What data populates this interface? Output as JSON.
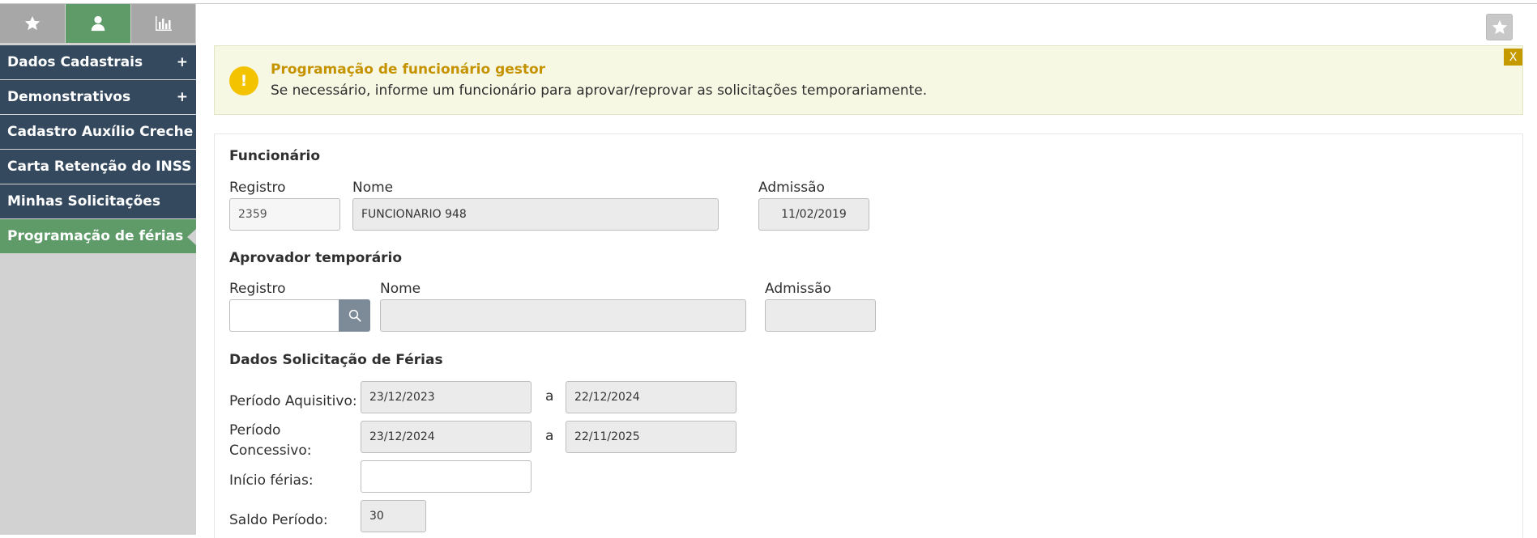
{
  "sidebar": {
    "tabs": [
      {
        "icon": "star-icon",
        "active": false
      },
      {
        "icon": "user-icon",
        "active": true
      },
      {
        "icon": "bar-chart-icon",
        "active": false
      }
    ],
    "items": [
      {
        "label": "Dados Cadastrais",
        "expand": "+"
      },
      {
        "label": "Demonstrativos",
        "expand": "+"
      },
      {
        "label": "Cadastro Auxílio Creche"
      },
      {
        "label": "Carta Retenção do INSS"
      },
      {
        "label": "Minhas Solicitações"
      },
      {
        "label": "Programação de férias",
        "active": true
      }
    ]
  },
  "alert": {
    "title": "Programação de funcionário gestor",
    "text": "Se necessário, informe um funcionário para aprovar/reprovar as solicitações temporariamente.",
    "icon_glyph": "!",
    "close_label": "X",
    "title_color": "#c59300"
  },
  "funcionario": {
    "title": "Funcionário",
    "registro_label": "Registro",
    "registro_value": "2359",
    "nome_label": "Nome",
    "nome_value": "FUNCIONARIO 948",
    "admissao_label": "Admissão",
    "admissao_value": "11/02/2019"
  },
  "aprovador": {
    "title": "Aprovador temporário",
    "registro_label": "Registro",
    "registro_value": "",
    "nome_label": "Nome",
    "nome_value": "",
    "admissao_label": "Admissão",
    "admissao_value": ""
  },
  "ferias": {
    "title": "Dados Solicitação de Férias",
    "aquisitivo_label": "Período Aquisitivo:",
    "aquisitivo_start": "23/12/2023",
    "aquisitivo_end": "22/12/2024",
    "concessivo_label_1": "Período",
    "concessivo_label_2": "Concessivo:",
    "concessivo_start": "23/12/2024",
    "concessivo_end": "22/11/2025",
    "sep": "a",
    "inicio_label": "Início férias:",
    "inicio_value": "",
    "saldo_label": "Saldo Período:",
    "saldo_value": "30"
  },
  "colors": {
    "sidebar_item": "#34495e",
    "accent_green": "#5f9b68",
    "alert_bg": "#f7f8e3"
  }
}
